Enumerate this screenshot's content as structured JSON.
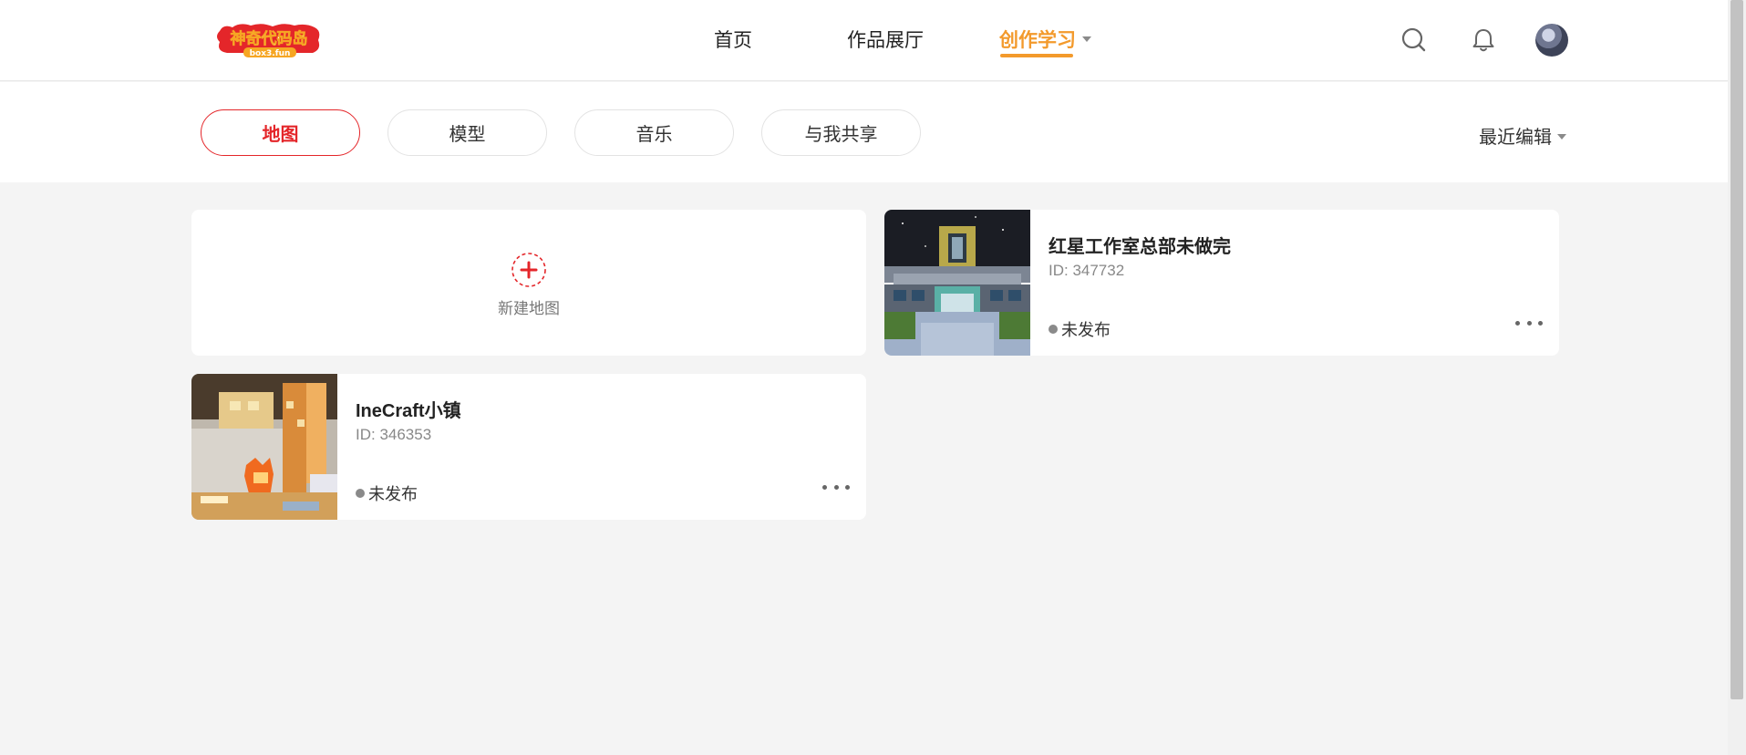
{
  "logo": {
    "text": "神奇代码岛",
    "subtext": "box3.fun",
    "colors": {
      "primary": "#e4262a",
      "accent": "#f6a623"
    }
  },
  "nav": {
    "items": [
      {
        "label": "首页"
      },
      {
        "label": "作品展厅"
      },
      {
        "label": "创作学习",
        "active": true,
        "has_dropdown": true
      }
    ],
    "icons": [
      "search-icon",
      "bell-icon",
      "avatar"
    ]
  },
  "filters": {
    "tabs": [
      {
        "label": "地图",
        "active": true
      },
      {
        "label": "模型"
      },
      {
        "label": "音乐"
      },
      {
        "label": "与我共享"
      }
    ],
    "sort_label": "最近编辑"
  },
  "new_map": {
    "label": "新建地图",
    "icon": "plus-circle-icon"
  },
  "maps": [
    {
      "title": "红星工作室总部未做完",
      "id_text": "ID: 347732",
      "status": "未发布"
    },
    {
      "title": "IneCraft小镇",
      "id_text": "ID: 346353",
      "status": "未发布"
    }
  ],
  "colors": {
    "accent_orange": "#f39a2c",
    "accent_red": "#e4262a",
    "background": "#f4f4f4"
  }
}
